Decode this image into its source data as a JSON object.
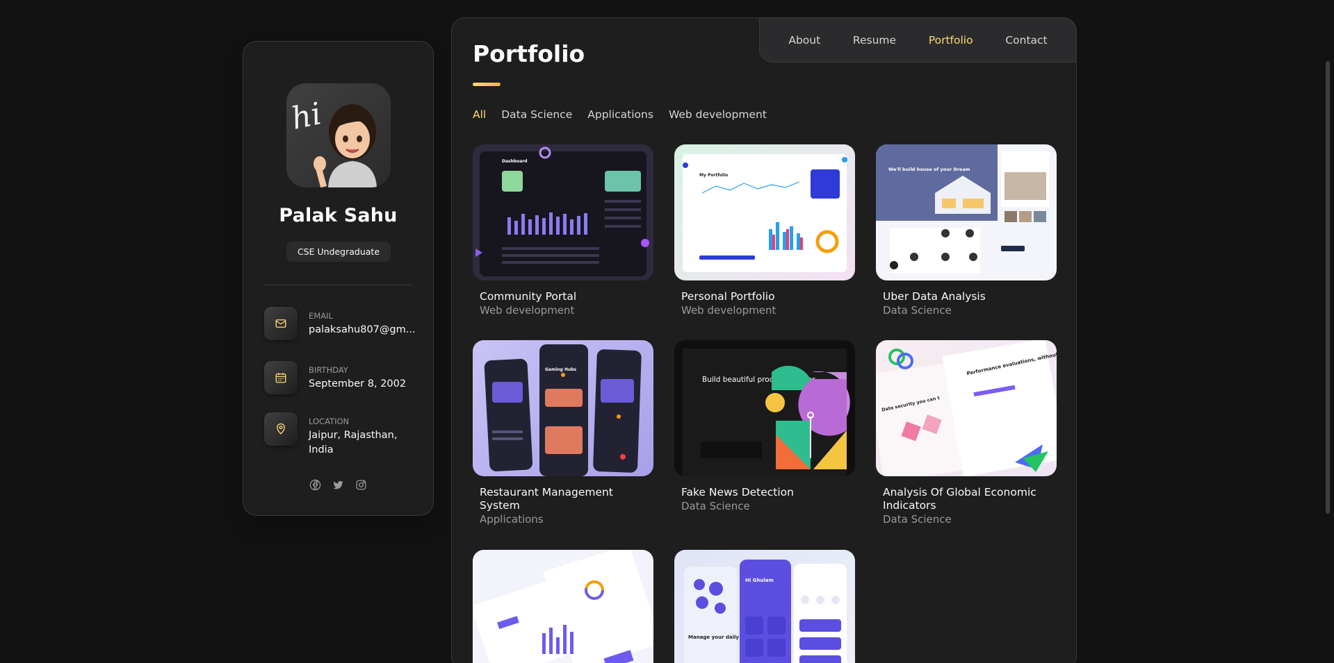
{
  "profile": {
    "name": "Palak Sahu",
    "title": "CSE Undegraduate",
    "avatar_text": "hi"
  },
  "contacts": [
    {
      "label": "Email",
      "value": "palaksahu807@gm...",
      "icon": "mail-icon"
    },
    {
      "label": "Birthday",
      "value": "September 8, 2002",
      "icon": "calendar-icon"
    },
    {
      "label": "Location",
      "value": "Jaipur, Rajasthan, India",
      "icon": "location-pin-icon"
    }
  ],
  "socials": [
    "facebook-icon",
    "twitter-icon",
    "instagram-icon"
  ],
  "nav": {
    "items": [
      "About",
      "Resume",
      "Portfolio",
      "Contact"
    ],
    "active": "Portfolio"
  },
  "page": {
    "title": "Portfolio"
  },
  "filters": {
    "items": [
      "All",
      "Data Science",
      "Applications",
      "Web development"
    ],
    "active": "All"
  },
  "projects": [
    {
      "title": "Community Portal",
      "category": "Web development"
    },
    {
      "title": "Personal Portfolio",
      "category": "Web development"
    },
    {
      "title": "Uber Data Analysis",
      "category": "Data Science"
    },
    {
      "title": "Restaurant Management System",
      "category": "Applications"
    },
    {
      "title": "Fake News Detection",
      "category": "Data Science"
    },
    {
      "title": "Analysis Of Global Economic Indicators",
      "category": "Data Science"
    },
    {
      "title": "",
      "category": ""
    },
    {
      "title": "",
      "category": ""
    }
  ],
  "thumb_text": {
    "dashboard": "Dashboard",
    "portfolio": "My Portfolio",
    "house": "We'll build house of your Dream",
    "gaming": "Gaming Hubs",
    "build": "Build beautiful products, faster.",
    "security": "Data security you can t",
    "performance": "Performance evaluations, without the bias",
    "greeting": "Hi Ghulam",
    "tasks": "Manage your daily tasks"
  },
  "colors": {
    "accent": "#ffdb70",
    "background": "#121212",
    "card": "#1e1e1f",
    "border": "#383838"
  }
}
